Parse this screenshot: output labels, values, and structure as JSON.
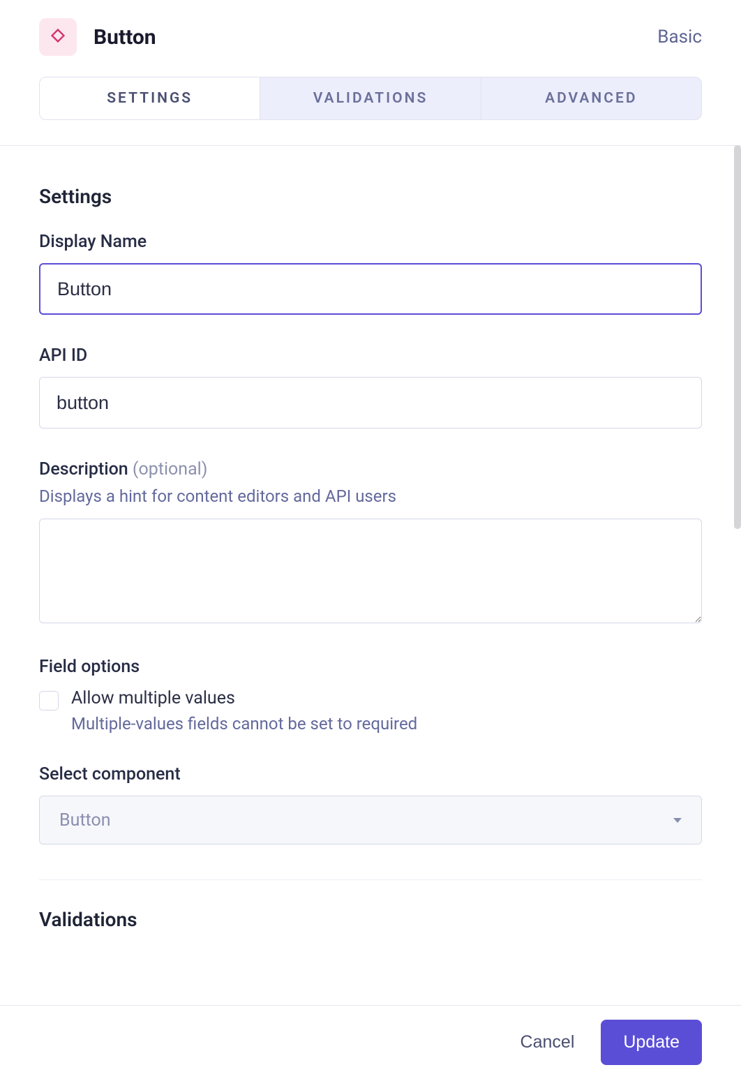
{
  "header": {
    "title": "Button",
    "type_label": "Basic",
    "icon_name": "diamond-icon"
  },
  "tabs": [
    {
      "label": "SETTINGS",
      "active": true
    },
    {
      "label": "VALIDATIONS",
      "active": false
    },
    {
      "label": "ADVANCED",
      "active": false
    }
  ],
  "settings": {
    "section_title": "Settings",
    "display_name": {
      "label": "Display Name",
      "value": "Button"
    },
    "api_id": {
      "label": "API ID",
      "value": "button"
    },
    "description": {
      "label": "Description",
      "optional": "(optional)",
      "hint": "Displays a hint for content editors and API users",
      "value": ""
    },
    "field_options": {
      "label": "Field options",
      "allow_multiple": {
        "label": "Allow multiple values",
        "sub": "Multiple-values fields cannot be set to required",
        "checked": false
      }
    },
    "select_component": {
      "label": "Select component",
      "value": "Button"
    }
  },
  "validations": {
    "section_title": "Validations"
  },
  "footer": {
    "cancel_label": "Cancel",
    "update_label": "Update"
  }
}
